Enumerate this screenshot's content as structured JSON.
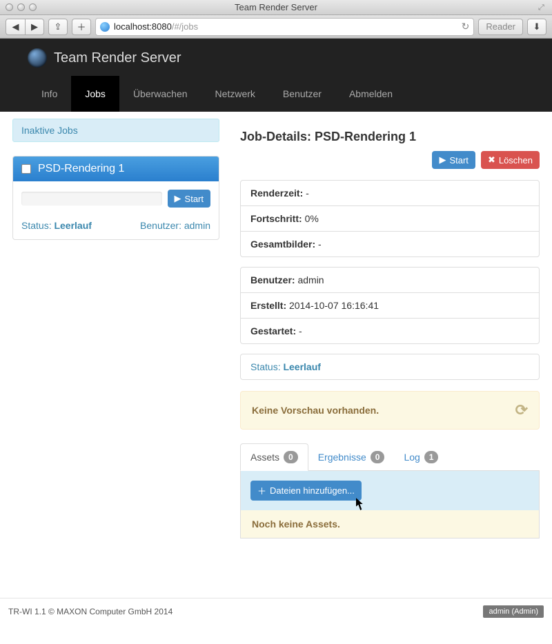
{
  "window": {
    "title": "Team Render Server",
    "url_host": "localhost:8080",
    "url_path": "/#/jobs",
    "reader_label": "Reader"
  },
  "brand": {
    "title": "Team Render Server"
  },
  "nav": {
    "items": [
      {
        "label": "Info"
      },
      {
        "label": "Jobs",
        "active": true
      },
      {
        "label": "Überwachen"
      },
      {
        "label": "Netzwerk"
      },
      {
        "label": "Benutzer"
      },
      {
        "label": "Abmelden"
      }
    ]
  },
  "sidebar": {
    "inactive_label": "Inaktive Jobs",
    "job": {
      "title": "PSD-Rendering 1",
      "start_label": "Start",
      "status_prefix": "Status: ",
      "status_value": "Leerlauf",
      "user_prefix": "Benutzer: ",
      "user_value": "admin"
    }
  },
  "details": {
    "title_prefix": "Job-Details: ",
    "title_value": "PSD-Rendering 1",
    "start_label": "Start",
    "delete_label": "Löschen",
    "fields": {
      "renderzeit_label": "Renderzeit:",
      "renderzeit_value": "-",
      "fortschritt_label": "Fortschritt:",
      "fortschritt_value": "0%",
      "gesamtbilder_label": "Gesamtbilder:",
      "gesamtbilder_value": "-",
      "benutzer_label": "Benutzer:",
      "benutzer_value": "admin",
      "erstellt_label": "Erstellt:",
      "erstellt_value": "2014-10-07 16:16:41",
      "gestartet_label": "Gestartet:",
      "gestartet_value": "-"
    },
    "status_prefix": "Status: ",
    "status_value": "Leerlauf",
    "no_preview": "Keine Vorschau vorhanden.",
    "tabs": {
      "assets_label": "Assets",
      "assets_count": "0",
      "results_label": "Ergebnisse",
      "results_count": "0",
      "log_label": "Log",
      "log_count": "1"
    },
    "add_files_label": "Dateien hinzufügen...",
    "no_assets": "Noch keine Assets."
  },
  "footer": {
    "copyright": "TR-WI 1.1 © MAXON Computer GmbH 2014",
    "user_badge": "admin (Admin)"
  }
}
